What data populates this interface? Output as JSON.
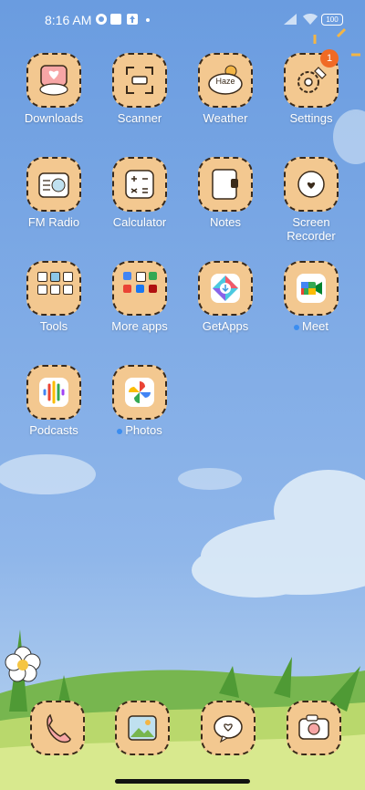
{
  "status": {
    "time": "8:16 AM",
    "battery_label": "100",
    "icons": [
      "app-notification-icon",
      "square-icon",
      "upload-icon",
      "dot-icon",
      "signal-icon",
      "wifi-icon",
      "battery-icon"
    ]
  },
  "apps": [
    {
      "label": "Downloads"
    },
    {
      "label": "Scanner"
    },
    {
      "label": "Weather",
      "icon_text": "Haze"
    },
    {
      "label": "Settings",
      "badge": "1"
    },
    {
      "label": "FM Radio"
    },
    {
      "label": "Calculator"
    },
    {
      "label": "Notes"
    },
    {
      "label": "Screen\nRecorder"
    },
    {
      "label": "Tools"
    },
    {
      "label": "More apps"
    },
    {
      "label": "GetApps"
    },
    {
      "label": "Meet"
    },
    {
      "label": "Podcasts"
    },
    {
      "label": "Photos"
    }
  ],
  "colors": {
    "sky_top": "#6a9ce0",
    "sky_bottom": "#a9c9ec",
    "tile": "#f3c890",
    "accent_badge": "#f06a25",
    "new_dot": "#3b8df0",
    "grass": "#6fb14a"
  }
}
